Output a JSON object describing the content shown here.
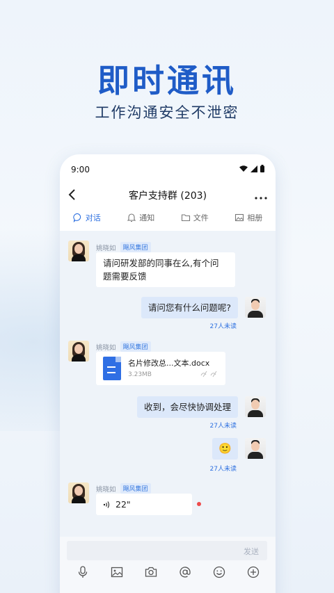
{
  "hero": {
    "title": "即时通讯",
    "subtitle": "工作沟通安全不泄密"
  },
  "status_bar": {
    "time": "9:00",
    "icons": [
      "wifi-icon",
      "signal-icon",
      "battery-icon"
    ]
  },
  "header": {
    "title": "客户支持群 (203)",
    "back_icon": "chevron-left-icon",
    "more_icon": "more-dots-icon"
  },
  "tabs": [
    {
      "label": "对话",
      "icon": "chat-bubble-icon",
      "active": true
    },
    {
      "label": "通知",
      "icon": "bell-icon",
      "active": false
    },
    {
      "label": "文件",
      "icon": "folder-icon",
      "active": false
    },
    {
      "label": "相册",
      "icon": "image-icon",
      "active": false
    }
  ],
  "messages": [
    {
      "direction": "in",
      "sender": "姚晓如",
      "org": "飓风集团",
      "type": "text",
      "text_line1": "请问研发部的同事在么,有个问",
      "text_line2": "题需要反馈"
    },
    {
      "direction": "out",
      "type": "text",
      "text": "请问您有什么问题呢?",
      "read_status": "27人未读"
    },
    {
      "direction": "in",
      "sender": "姚晓如",
      "org": "飓风集团",
      "type": "file",
      "file_name": "名片修改总...文本.docx",
      "file_size": "3.23MB"
    },
    {
      "direction": "out",
      "type": "text",
      "text": "收到，会尽快协调处理",
      "read_status": "27人未读"
    },
    {
      "direction": "out",
      "type": "emoji",
      "text": "🙂",
      "read_status": "27人未读"
    },
    {
      "direction": "in",
      "sender": "姚晓如",
      "org": "飓风集团",
      "type": "voice",
      "duration": "22\""
    }
  ],
  "input": {
    "send_label": "发送"
  },
  "toolbar_icons": [
    "microphone-icon",
    "picture-icon",
    "camera-icon",
    "at-icon",
    "emoji-icon",
    "plus-icon"
  ],
  "colors": {
    "accent": "#2c6fe0",
    "hero_title": "#1f5cc7",
    "bubble_out": "#dce8fa",
    "unread_dot": "#ee4b4b"
  }
}
